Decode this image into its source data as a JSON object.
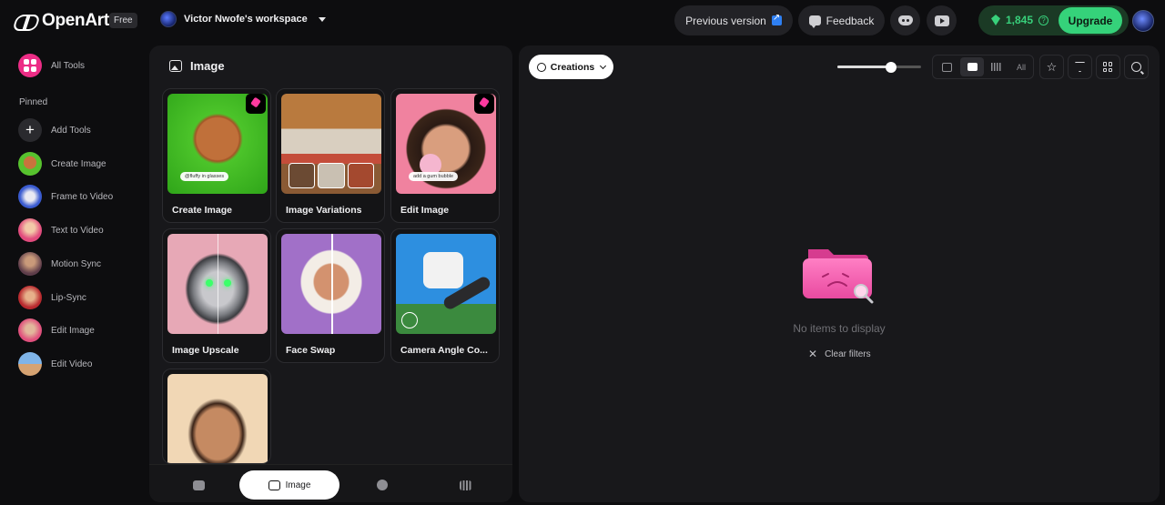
{
  "header": {
    "brand": "OpenArt",
    "plan_badge": "Free",
    "workspace_name": "Victor Nwofe's workspace",
    "previous_version_label": "Previous version",
    "feedback_label": "Feedback",
    "credits": "1,845",
    "upgrade_label": "Upgrade",
    "colors": {
      "accent_green": "#35d27a",
      "brand_pink": "#ec2d86"
    }
  },
  "sidebar": {
    "all_tools_label": "All Tools",
    "pinned_label": "Pinned",
    "items": [
      {
        "label": "Add Tools",
        "icon": "plus-icon"
      },
      {
        "label": "Create Image",
        "icon": "create-image-thumb"
      },
      {
        "label": "Frame to Video",
        "icon": "frame-to-video-thumb"
      },
      {
        "label": "Text to Video",
        "icon": "text-to-video-thumb"
      },
      {
        "label": "Motion Sync",
        "icon": "motion-sync-thumb"
      },
      {
        "label": "Lip-Sync",
        "icon": "lip-sync-thumb"
      },
      {
        "label": "Edit Image",
        "icon": "edit-image-thumb"
      },
      {
        "label": "Edit Video",
        "icon": "edit-video-thumb"
      }
    ]
  },
  "tools_panel": {
    "title": "Image",
    "cards": [
      {
        "label": "Create Image",
        "pinned": true,
        "tag": "@fluffy in glasses"
      },
      {
        "label": "Image Variations",
        "pinned": false
      },
      {
        "label": "Edit Image",
        "pinned": true,
        "tag": "add a gum bubble"
      },
      {
        "label": "Image Upscale",
        "pinned": false
      },
      {
        "label": "Face Swap",
        "pinned": false
      },
      {
        "label": "Camera Angle Co...",
        "pinned": false
      },
      {
        "label": "",
        "pinned": false
      }
    ],
    "tabs": [
      {
        "label": "",
        "icon": "video-icon"
      },
      {
        "label": "Image",
        "icon": "image-icon",
        "active": true
      },
      {
        "label": "",
        "icon": "face-icon"
      },
      {
        "label": "",
        "icon": "audio-icon"
      }
    ]
  },
  "canvas": {
    "creations_label": "Creations",
    "zoom_level": 0.64,
    "filter_all_label": "All",
    "empty_message": "No items to display",
    "clear_filters_label": "Clear filters"
  }
}
